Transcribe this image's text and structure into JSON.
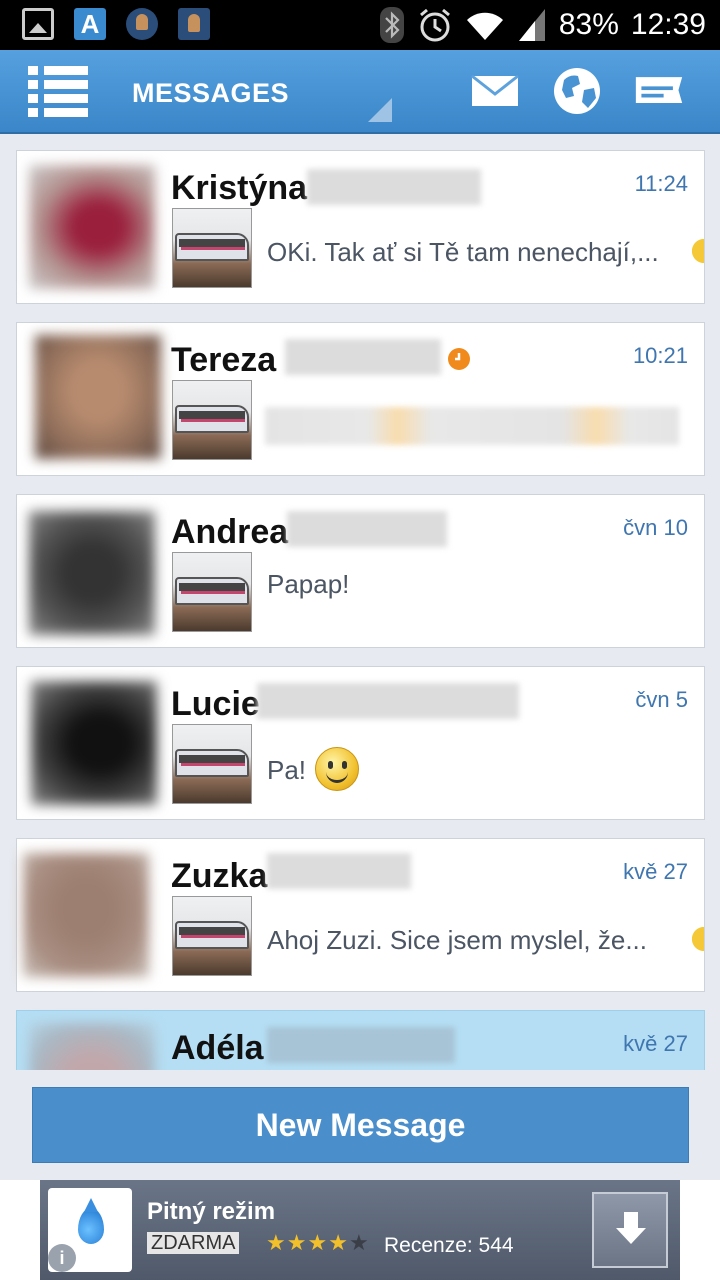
{
  "status_bar": {
    "battery": "83%",
    "time": "12:39",
    "icons": [
      "image-icon",
      "a-app-icon",
      "avatar-app-icon",
      "avatar-app-icon-2",
      "bluetooth-icon",
      "alarm-icon",
      "wifi-icon",
      "signal-icon"
    ]
  },
  "header": {
    "title": "MESSAGES",
    "icons": [
      "menu-icon",
      "mail-icon",
      "globe-icon",
      "message-board-icon"
    ]
  },
  "conversations": [
    {
      "name": "Kristýna",
      "time": "11:24",
      "preview": "OKi. Tak ať si Tě tam nenechají,..."
    },
    {
      "name": "Tereza",
      "time": "10:21",
      "preview": ""
    },
    {
      "name": "Andrea",
      "time": "čvn 10",
      "preview": "Papap!"
    },
    {
      "name": "Lucie",
      "time": "čvn 5",
      "preview": "Pa!"
    },
    {
      "name": "Zuzka",
      "time": "kvě 27",
      "preview": "Ahoj Zuzi. Sice jsem myslel, že..."
    },
    {
      "name": "Adéla",
      "time": "kvě 27",
      "preview": ""
    }
  ],
  "new_message_button": "New Message",
  "ad": {
    "title": "Pitný režim",
    "badge": "ZDARMA",
    "rating": 4,
    "rating_max": 5,
    "reviews": "Recenze: 544"
  },
  "colors": {
    "header": "#3a86c8",
    "accent_time": "#3f76b0",
    "selected_row": "#b5def4",
    "button": "#4a8ecb",
    "unread_dot": "#f08a1c"
  }
}
